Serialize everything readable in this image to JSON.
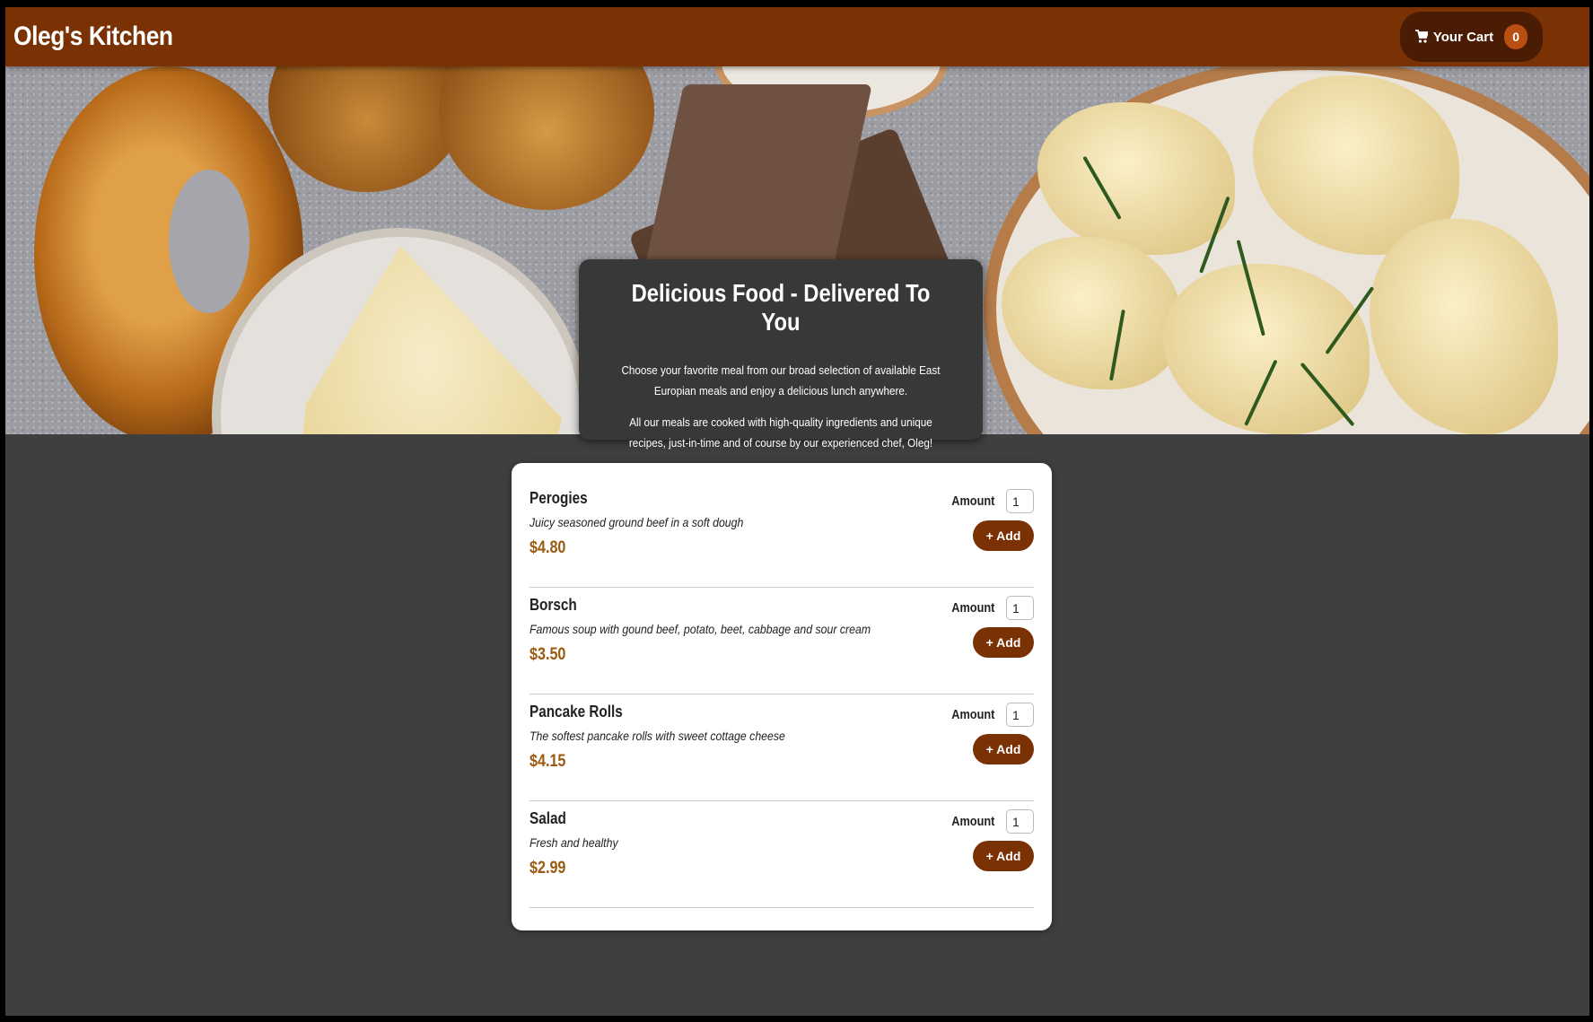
{
  "header": {
    "brand": "Oleg's Kitchen",
    "cart": {
      "label": "Your Cart",
      "count": "0",
      "icon": "cart-icon"
    }
  },
  "summary": {
    "title": "Delicious Food - Delivered To You",
    "paragraph1": "Choose your favorite meal from our broad selection of available East Europian meals and enjoy a delicious lunch anywhere.",
    "paragraph2": "All our meals are cooked with high-quality ingredients and unique recipes, just-in-time and of course by our experienced chef, Oleg!"
  },
  "meals": [
    {
      "name": "Perogies",
      "description": "Juicy seasoned ground beef in a soft dough",
      "price": "$4.80",
      "amount_label": "Amount",
      "amount": "1",
      "add_label": "+ Add"
    },
    {
      "name": "Borsch",
      "description": "Famous soup with gound beef, potato, beet, cabbage and sour cream",
      "price": "$3.50",
      "amount_label": "Amount",
      "amount": "1",
      "add_label": "+ Add"
    },
    {
      "name": "Pancake Rolls",
      "description": "The softest pancake rolls with sweet cottage cheese",
      "price": "$4.15",
      "amount_label": "Amount",
      "amount": "1",
      "add_label": "+ Add"
    },
    {
      "name": "Salad",
      "description": "Fresh and healthy",
      "price": "$2.99",
      "amount_label": "Amount",
      "amount": "1",
      "add_label": "+ Add"
    }
  ],
  "colors": {
    "header": "#7a3104",
    "cart_button": "#4a1c04",
    "badge": "#b94f12",
    "background": "#3f3f3f",
    "price": "#9a5a10"
  }
}
